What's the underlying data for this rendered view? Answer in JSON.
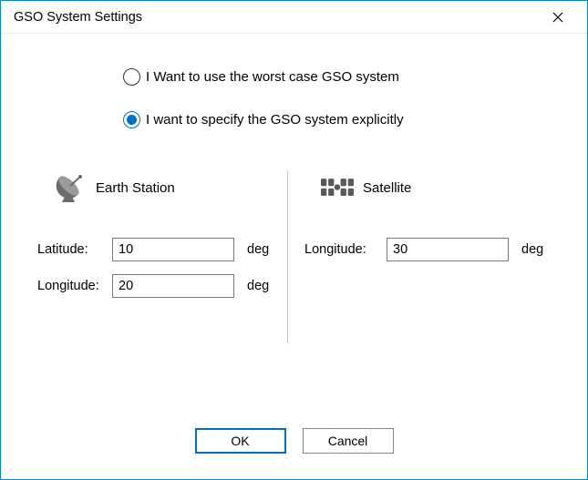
{
  "window": {
    "title": "GSO System Settings"
  },
  "radios": {
    "worst_case": "I Want to use the worst case GSO system",
    "explicit": "I want to specify the GSO system explicitly",
    "selected": "explicit"
  },
  "earth_station": {
    "title": "Earth Station",
    "latitude_label": "Latitude:",
    "latitude_value": "10",
    "latitude_unit": "deg",
    "longitude_label": "Longitude:",
    "longitude_value": "20",
    "longitude_unit": "deg"
  },
  "satellite": {
    "title": "Satellite",
    "longitude_label": "Longitude:",
    "longitude_value": "30",
    "longitude_unit": "deg"
  },
  "buttons": {
    "ok": "OK",
    "cancel": "Cancel"
  }
}
